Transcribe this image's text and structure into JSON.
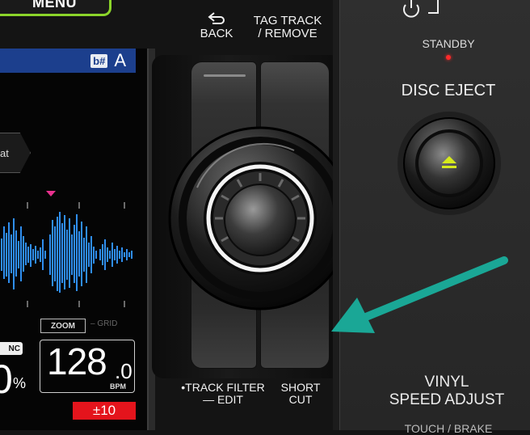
{
  "menu": {
    "label": "MENU"
  },
  "screen": {
    "key_symbol": "b#",
    "key_value": "A",
    "format_tag": "at",
    "zoom_label": "ZOOM",
    "grid_label": "GRID",
    "sync_label": "NC",
    "pitch_value": "0",
    "pitch_unit": "%",
    "bpm_integer": "128",
    "bpm_decimal": ".0",
    "bpm_label": "BPM",
    "range_label": "±10"
  },
  "controls": {
    "back_label": "BACK",
    "tag_track_line1": "TAG TRACK",
    "tag_track_line2": "/ REMOVE",
    "track_filter_line1": "•TRACK FILTER",
    "track_filter_line2": "— EDIT",
    "short_cut_line1": "SHORT",
    "short_cut_line2": "CUT"
  },
  "right_panel": {
    "standby_label": "STANDBY",
    "disc_eject_label": "DISC EJECT",
    "vinyl_line1": "VINYL",
    "vinyl_line2": "SPEED ADJUST",
    "touch_brake_label": "TOUCH / BRAKE"
  },
  "colors": {
    "menu_border": "#8bd42a",
    "key_bar": "#1c3f8d",
    "waveform": "#2f8ef0",
    "playhead": "#e8318e",
    "range_badge": "#e4141c",
    "eject_icon": "#d6ea1c",
    "standby_led": "#ff2a2a",
    "annotation_arrow": "#1aa796"
  },
  "icons": {
    "back": "back-arrow-icon",
    "power": "power-icon",
    "eject": "eject-icon",
    "annotation": "pointer-arrow-icon"
  }
}
